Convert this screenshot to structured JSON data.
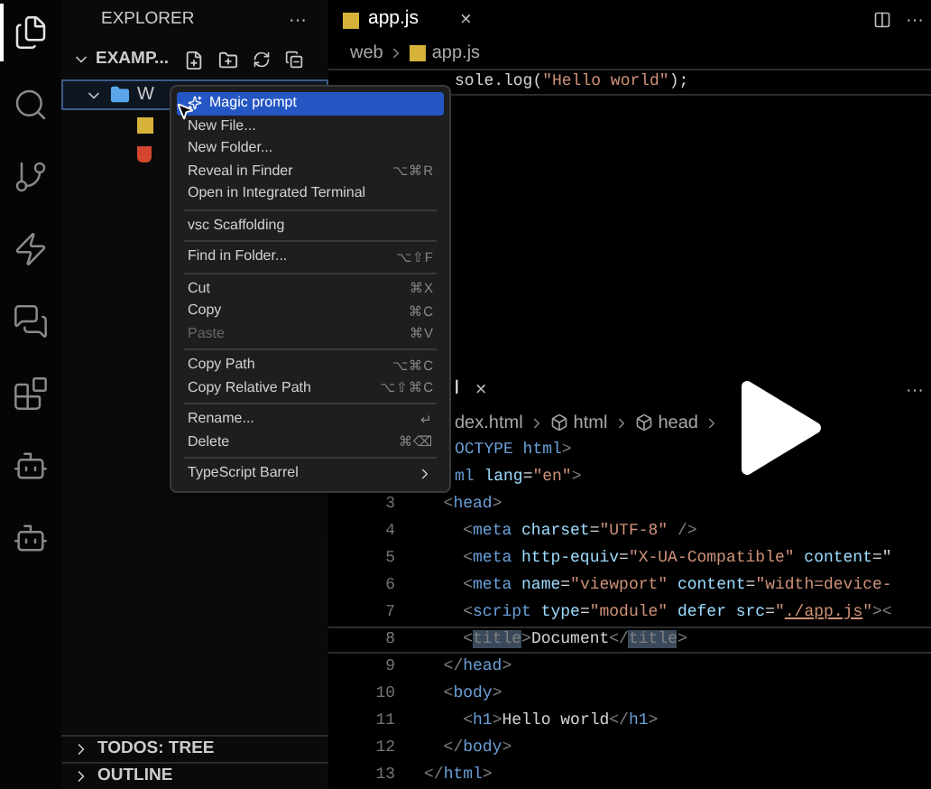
{
  "activity_bar": [
    {
      "kind": "files",
      "selected": true
    },
    {
      "kind": "search",
      "selected": false
    },
    {
      "kind": "git",
      "selected": false
    },
    {
      "kind": "bolt",
      "selected": false
    },
    {
      "kind": "chat",
      "selected": false
    },
    {
      "kind": "extensions",
      "selected": false
    },
    {
      "kind": "bot",
      "selected": false
    },
    {
      "kind": "bot",
      "selected": false
    }
  ],
  "sidebar": {
    "title": "EXPLORER",
    "more": "···",
    "root": {
      "label": "EXAMP...",
      "expanded": true
    },
    "tree": [
      {
        "label": "W",
        "kind": "folder",
        "expanded": true,
        "selected": true,
        "children": [
          {
            "kind": "js"
          },
          {
            "kind": "html"
          }
        ]
      }
    ],
    "panels": [
      {
        "label": "TODOS: TREE",
        "expanded": false
      },
      {
        "label": "OUTLINE",
        "expanded": false
      }
    ]
  },
  "editor_groups": [
    {
      "tabs": [
        {
          "label": "app.js",
          "kind": "js",
          "selected": true,
          "close": "×"
        }
      ],
      "more": "···",
      "split": true,
      "breadcrumb": [
        {
          "label": "web",
          "kind": "text",
          "separator_after": true
        },
        {
          "label": "app.js",
          "kind": "js",
          "separator_after": false
        }
      ],
      "lines": [
        {
          "current": true,
          "tokens": [
            {
              "kind": "text",
              "text": "sole.log("
            },
            {
              "kind": "string",
              "text": "\"Hello world\""
            },
            {
              "kind": "text",
              "text": ");"
            }
          ]
        }
      ]
    },
    {
      "tabs": [
        {
          "label": "l",
          "kind": "text",
          "selected": true,
          "close": "×"
        }
      ],
      "more": "···",
      "breadcrumb": [
        {
          "label": "dex.html",
          "kind": "text",
          "separator_after": true
        },
        {
          "label": "html",
          "kind": "symbol",
          "separator_after": true
        },
        {
          "label": "head",
          "kind": "symbol",
          "separator_after": true
        }
      ],
      "lines": [
        {
          "current": false,
          "tokens": [
            {
              "kind": "tag",
              "text": "OCTYPE html"
            },
            {
              "kind": "punct",
              "text": ">"
            }
          ]
        },
        {
          "current": false,
          "tokens": [
            {
              "kind": "tag",
              "text": "ml"
            },
            {
              "kind": "attr",
              "text": " lang"
            },
            {
              "kind": "text",
              "text": "="
            },
            {
              "kind": "string",
              "text": "\"en\""
            },
            {
              "kind": "punct",
              "text": ">"
            }
          ]
        },
        {
          "number": "3",
          "current": false,
          "tokens": [
            {
              "kind": "punct",
              "text": "  <"
            },
            {
              "kind": "tag",
              "text": "head"
            },
            {
              "kind": "punct",
              "text": ">"
            }
          ]
        },
        {
          "number": "4",
          "current": false,
          "tokens": [
            {
              "kind": "punct",
              "text": "    <"
            },
            {
              "kind": "tag",
              "text": "meta"
            },
            {
              "kind": "attr",
              "text": " charset"
            },
            {
              "kind": "text",
              "text": "="
            },
            {
              "kind": "string",
              "text": "\"UTF-8\""
            },
            {
              "kind": "punct",
              "text": " />"
            }
          ]
        },
        {
          "number": "5",
          "current": false,
          "tokens": [
            {
              "kind": "punct",
              "text": "    <"
            },
            {
              "kind": "tag",
              "text": "meta"
            },
            {
              "kind": "attr",
              "text": " http-equiv"
            },
            {
              "kind": "text",
              "text": "="
            },
            {
              "kind": "string",
              "text": "\"X-UA-Compatible\""
            },
            {
              "kind": "attr",
              "text": " content"
            },
            {
              "kind": "text",
              "text": "=\""
            }
          ]
        },
        {
          "number": "6",
          "current": false,
          "tokens": [
            {
              "kind": "punct",
              "text": "    <"
            },
            {
              "kind": "tag",
              "text": "meta"
            },
            {
              "kind": "attr",
              "text": " name"
            },
            {
              "kind": "text",
              "text": "="
            },
            {
              "kind": "string",
              "text": "\"viewport\""
            },
            {
              "kind": "attr",
              "text": " content"
            },
            {
              "kind": "text",
              "text": "="
            },
            {
              "kind": "string",
              "text": "\"width=device-"
            }
          ]
        },
        {
          "number": "7",
          "current": false,
          "tokens": [
            {
              "kind": "punct",
              "text": "    <"
            },
            {
              "kind": "tag",
              "text": "script"
            },
            {
              "kind": "attr",
              "text": " type"
            },
            {
              "kind": "text",
              "text": "="
            },
            {
              "kind": "string",
              "text": "\"module\""
            },
            {
              "kind": "attr",
              "text": " defer src"
            },
            {
              "kind": "text",
              "text": "="
            },
            {
              "kind": "string",
              "text": "\""
            },
            {
              "kind": "link",
              "text": "./app.js"
            },
            {
              "kind": "string",
              "text": "\""
            },
            {
              "kind": "punct",
              "text": "><"
            }
          ]
        },
        {
          "number": "8",
          "current": true,
          "tokens": [
            {
              "kind": "punct",
              "text": "    <"
            },
            {
              "kind": "match",
              "text": "title"
            },
            {
              "kind": "punct",
              "text": ">"
            },
            {
              "kind": "text",
              "text": "Document"
            },
            {
              "kind": "punct",
              "text": "</"
            },
            {
              "kind": "match",
              "text": "title"
            },
            {
              "kind": "punct",
              "text": ">"
            }
          ]
        },
        {
          "number": "9",
          "current": false,
          "tokens": [
            {
              "kind": "punct",
              "text": "  </"
            },
            {
              "kind": "tag",
              "text": "head"
            },
            {
              "kind": "punct",
              "text": ">"
            }
          ]
        },
        {
          "number": "10",
          "current": false,
          "tokens": [
            {
              "kind": "punct",
              "text": "  <"
            },
            {
              "kind": "tag",
              "text": "body"
            },
            {
              "kind": "punct",
              "text": ">"
            }
          ]
        },
        {
          "number": "11",
          "current": false,
          "tokens": [
            {
              "kind": "punct",
              "text": "    <"
            },
            {
              "kind": "tag",
              "text": "h1"
            },
            {
              "kind": "punct",
              "text": ">"
            },
            {
              "kind": "text",
              "text": "Hello world"
            },
            {
              "kind": "punct",
              "text": "</"
            },
            {
              "kind": "tag",
              "text": "h1"
            },
            {
              "kind": "punct",
              "text": ">"
            }
          ]
        },
        {
          "number": "12",
          "current": false,
          "tokens": [
            {
              "kind": "punct",
              "text": "  </"
            },
            {
              "kind": "tag",
              "text": "body"
            },
            {
              "kind": "punct",
              "text": ">"
            }
          ]
        },
        {
          "number": "13",
          "current": false,
          "tokens": [
            {
              "kind": "punct",
              "text": "</"
            },
            {
              "kind": "tag",
              "text": "html"
            },
            {
              "kind": "punct",
              "text": ">"
            }
          ]
        }
      ]
    }
  ],
  "context_menu": [
    {
      "kind": "ai",
      "label": "Magic prompt",
      "selected": true,
      "disabled": false
    },
    {
      "kind": "item",
      "label": "New File...",
      "selected": false,
      "disabled": false
    },
    {
      "kind": "item",
      "label": "New Folder...",
      "selected": false,
      "disabled": false
    },
    {
      "kind": "item",
      "label": "Reveal in Finder",
      "shortcut": "⌥⌘R",
      "selected": false,
      "disabled": false
    },
    {
      "kind": "item",
      "label": "Open in Integrated Terminal",
      "selected": false,
      "disabled": false
    },
    {
      "kind": "separator"
    },
    {
      "kind": "item",
      "label": "vsc Scaffolding",
      "selected": false,
      "disabled": false
    },
    {
      "kind": "separator"
    },
    {
      "kind": "item",
      "label": "Find in Folder...",
      "shortcut": "⌥⇧F",
      "selected": false,
      "disabled": false
    },
    {
      "kind": "separator"
    },
    {
      "kind": "item",
      "label": "Cut",
      "shortcut": "⌘X",
      "selected": false,
      "disabled": false
    },
    {
      "kind": "item",
      "label": "Copy",
      "shortcut": "⌘C",
      "selected": false,
      "disabled": false
    },
    {
      "kind": "item",
      "label": "Paste",
      "shortcut": "⌘V",
      "selected": false,
      "disabled": true
    },
    {
      "kind": "separator"
    },
    {
      "kind": "item",
      "label": "Copy Path",
      "shortcut": "⌥⌘C",
      "selected": false,
      "disabled": false
    },
    {
      "kind": "item",
      "label": "Copy Relative Path",
      "shortcut": "⌥⇧⌘C",
      "selected": false,
      "disabled": false
    },
    {
      "kind": "separator"
    },
    {
      "kind": "item",
      "label": "Rename...",
      "shortcut": "↵",
      "selected": false,
      "disabled": false
    },
    {
      "kind": "item",
      "label": "Delete",
      "shortcut": "⌘⌫",
      "selected": false,
      "disabled": false
    },
    {
      "kind": "separator"
    },
    {
      "kind": "submenu",
      "label": "TypeScript Barrel",
      "selected": false,
      "disabled": false
    }
  ]
}
